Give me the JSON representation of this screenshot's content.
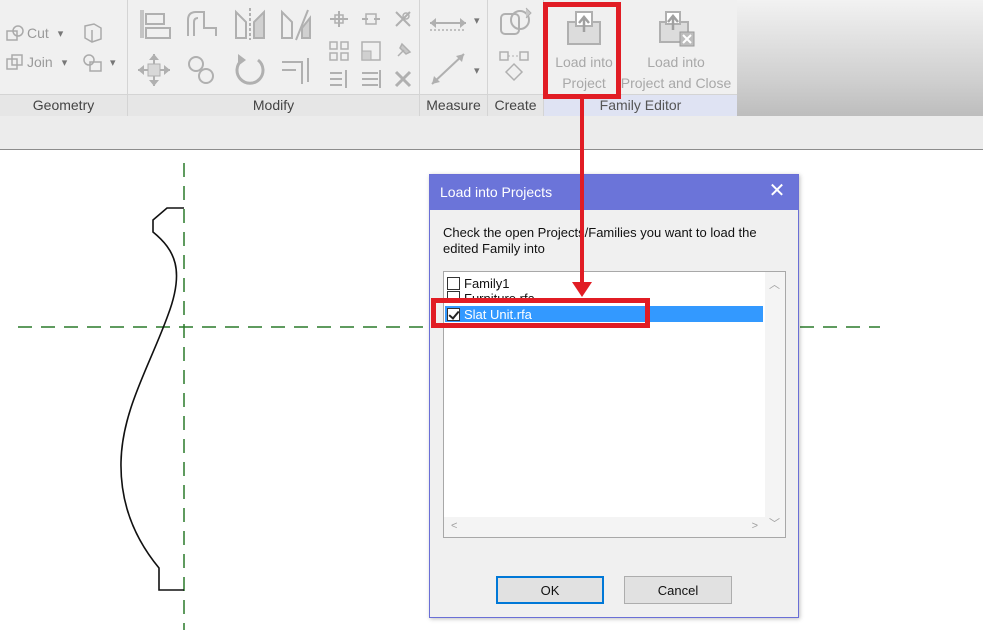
{
  "ribbon": {
    "geometry": {
      "cut_label": "Cut",
      "join_label": "Join",
      "title": "Geometry"
    },
    "modify": {
      "title": "Modify"
    },
    "measure": {
      "title": "Measure"
    },
    "create": {
      "title": "Create"
    },
    "family_editor": {
      "title": "Family Editor",
      "load_into_project": [
        "Load into",
        "Project"
      ],
      "load_into_project_close": [
        "Load into",
        "Project and Close"
      ]
    }
  },
  "dialog": {
    "title": "Load into Projects",
    "message": "Check the open Projects/Families you want to load the edited Family into",
    "items": [
      {
        "label": "Family1",
        "checked": false,
        "selected": false
      },
      {
        "label": "Furniture.rfa",
        "checked": false,
        "selected": false
      },
      {
        "label": "Slat Unit.rfa",
        "checked": true,
        "selected": true
      }
    ],
    "ok_label": "OK",
    "cancel_label": "Cancel",
    "close_glyph": "✕"
  },
  "icons": {
    "dropdown": "▾",
    "scroll_up": "︿",
    "scroll_down": "﹀",
    "scroll_left": "<",
    "scroll_right": ">"
  },
  "colors": {
    "annotation_red": "#e11c24",
    "dialog_titlebar": "#6b74d9",
    "selection": "#3399ff",
    "reference_line": "#2a7a2a"
  }
}
